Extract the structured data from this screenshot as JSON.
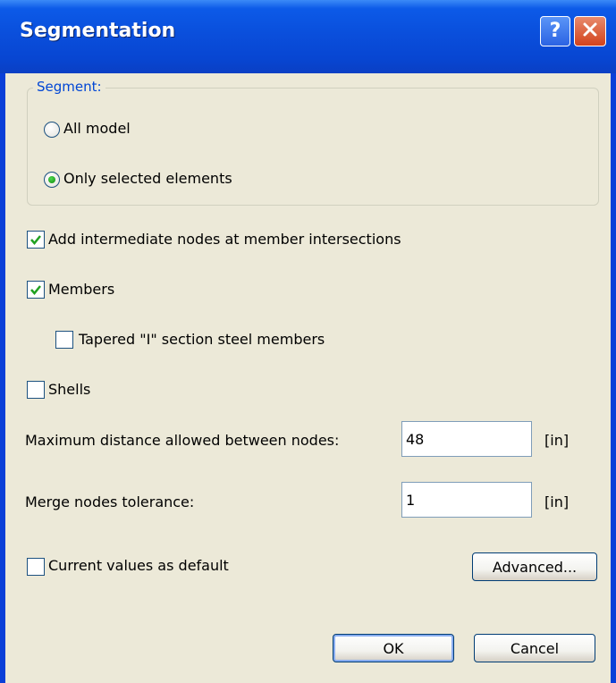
{
  "window": {
    "title": "Segmentation"
  },
  "segment_group": {
    "legend": "Segment:",
    "options": [
      {
        "label": "All model",
        "selected": false
      },
      {
        "label": "Only selected elements",
        "selected": true
      }
    ]
  },
  "checks": {
    "intermediate_nodes": {
      "label": "Add intermediate nodes at member intersections",
      "checked": true
    },
    "members": {
      "label": "Members",
      "checked": true
    },
    "tapered": {
      "label": "Tapered \"I\" section steel members",
      "checked": false
    },
    "shells": {
      "label": "Shells",
      "checked": false
    },
    "default_values": {
      "label": "Current values as default",
      "checked": false
    }
  },
  "fields": {
    "max_distance": {
      "label": "Maximum distance allowed between nodes:",
      "value": "48",
      "unit": "[in]"
    },
    "merge_tolerance": {
      "label": "Merge nodes tolerance:",
      "value": "1",
      "unit": "[in]"
    }
  },
  "buttons": {
    "advanced": "Advanced...",
    "ok": "OK",
    "cancel": "Cancel"
  },
  "colors": {
    "title_bar": "#0a4fdc",
    "client_bg": "#ece9d8",
    "group_legend": "#0046d5",
    "check_mark": "#21a121"
  }
}
